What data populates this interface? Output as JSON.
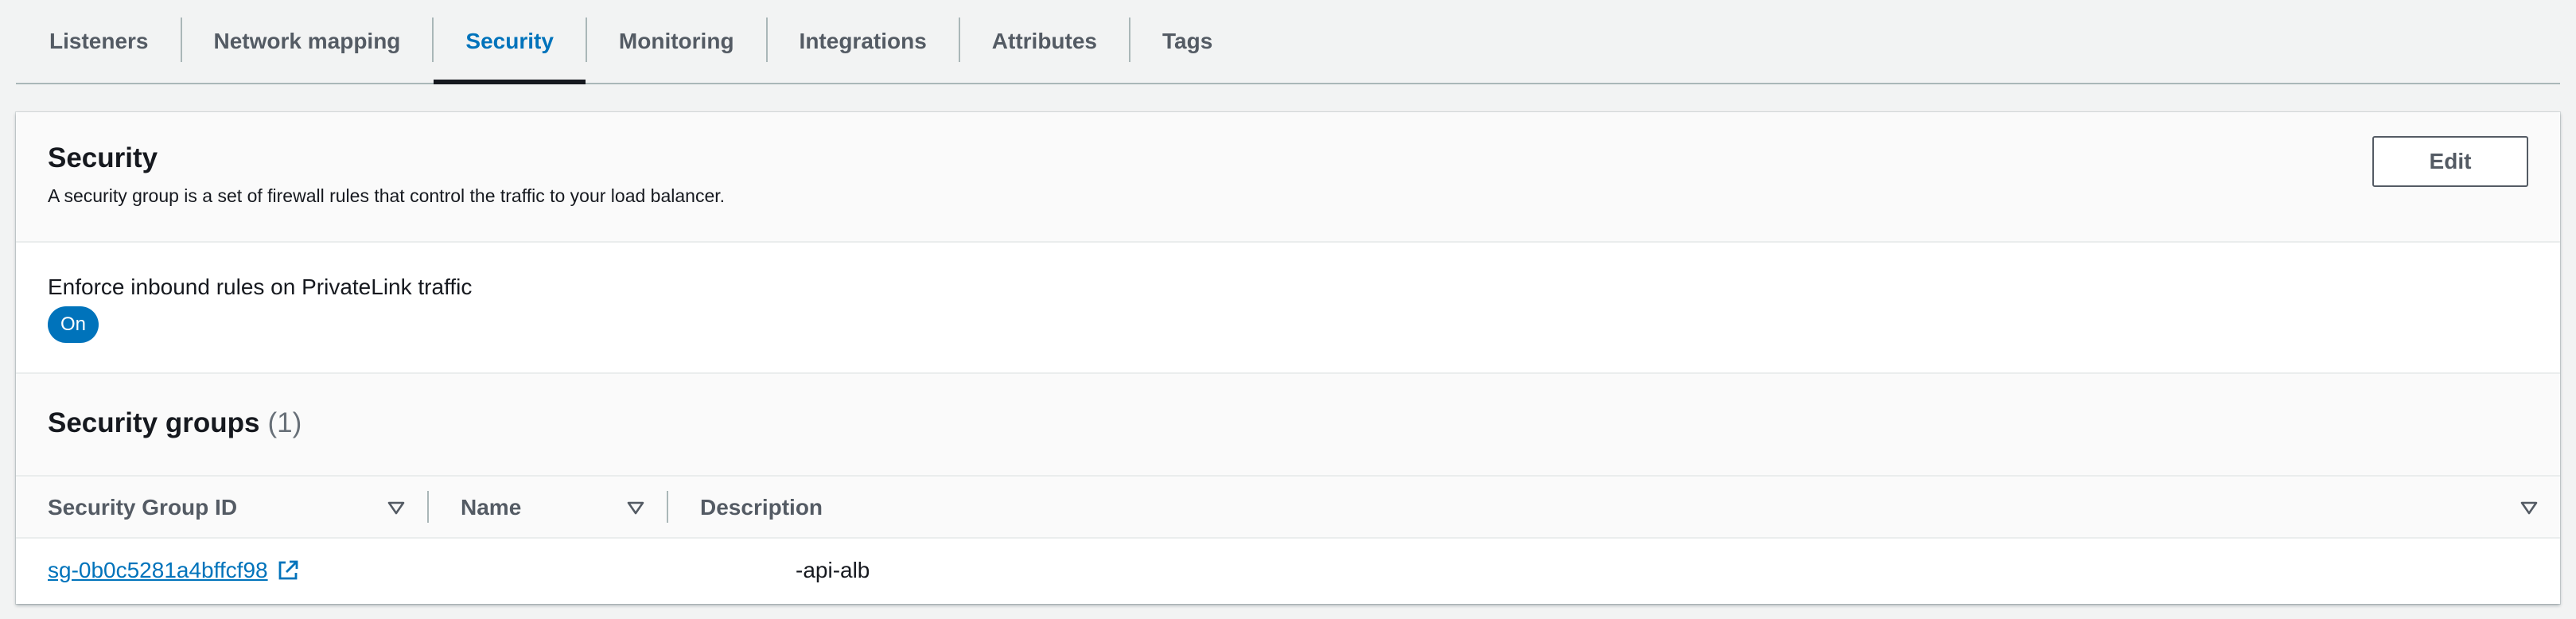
{
  "tabs": [
    {
      "label": "Listeners"
    },
    {
      "label": "Network mapping"
    },
    {
      "label": "Security",
      "active": true
    },
    {
      "label": "Monitoring"
    },
    {
      "label": "Integrations"
    },
    {
      "label": "Attributes"
    },
    {
      "label": "Tags"
    }
  ],
  "security": {
    "title": "Security",
    "description": "A security group is a set of firewall rules that control the traffic to your load balancer.",
    "edit_label": "Edit",
    "enforce_label": "Enforce inbound rules on PrivateLink traffic",
    "enforce_value": "On"
  },
  "security_groups": {
    "title": "Security groups",
    "count": "(1)",
    "columns": [
      "Security Group ID",
      "Name",
      "Description"
    ],
    "rows": [
      {
        "id": "sg-0b0c5281a4bffcf98",
        "name": "",
        "description": "-api-alb"
      }
    ]
  },
  "colors": {
    "accent": "#0073bb",
    "text": "#16191f",
    "muted": "#545b64",
    "border": "#eaeded",
    "background": "#f2f3f3"
  },
  "icons": [
    "sort-down-icon",
    "external-link-icon"
  ]
}
